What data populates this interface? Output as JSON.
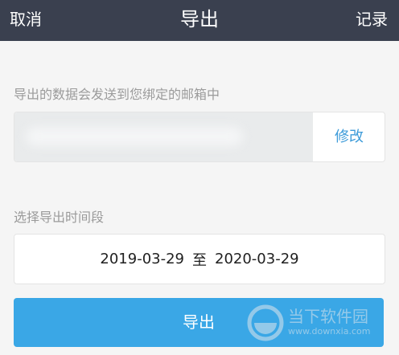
{
  "header": {
    "cancel_label": "取消",
    "title": "导出",
    "records_label": "记录"
  },
  "email_section": {
    "label": "导出的数据会发送到您绑定的邮箱中",
    "email_value": "",
    "modify_label": "修改"
  },
  "period_section": {
    "label": "选择导出时间段",
    "start_date": "2019-03-29",
    "separator": "至",
    "end_date": "2020-03-29"
  },
  "export_button": {
    "label": "导出"
  },
  "watermark": {
    "text": "当下软件园",
    "url": "www.downxia.com"
  },
  "colors": {
    "header_bg": "#3a404f",
    "accent_blue": "#3aa7e6",
    "link_blue": "#3d9bd9",
    "page_bg": "#f5f5f5"
  }
}
